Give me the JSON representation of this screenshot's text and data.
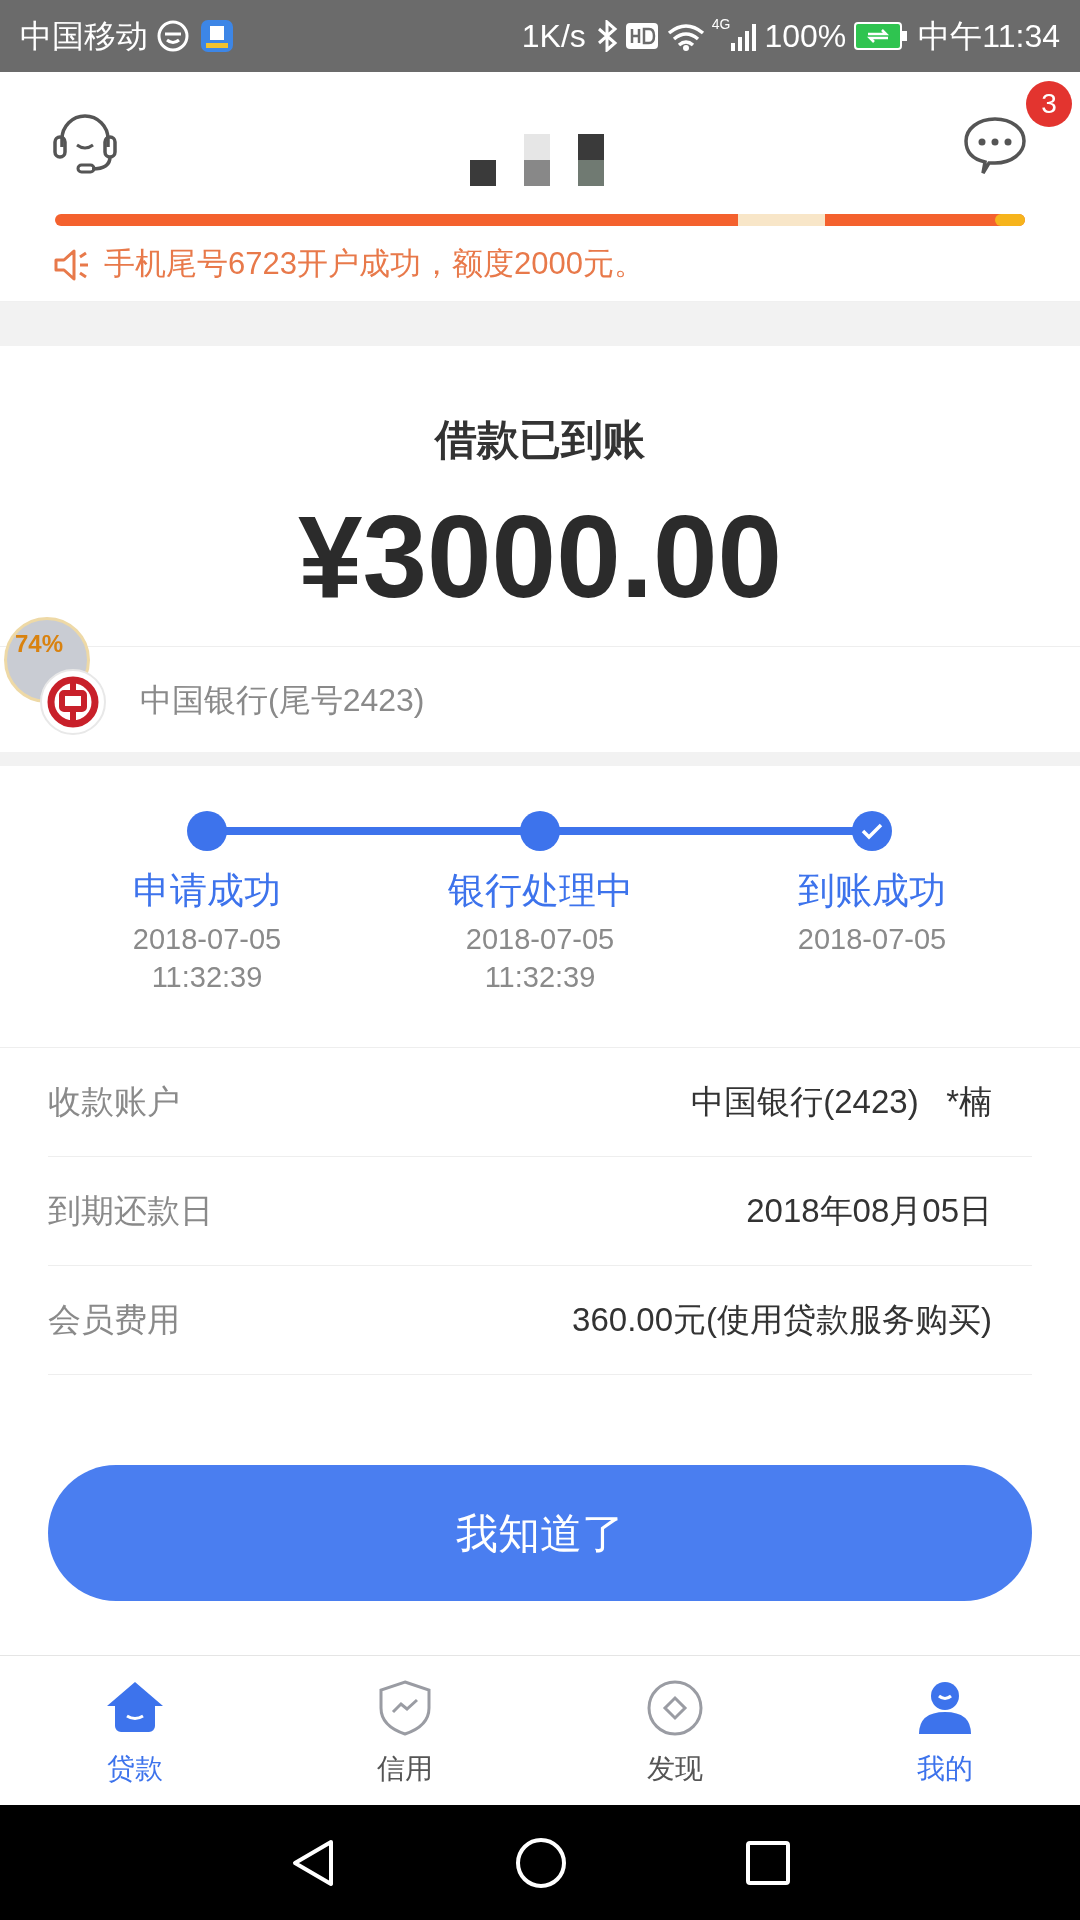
{
  "status_bar": {
    "carrier": "中国移动",
    "speed": "1K/s",
    "network": "4G",
    "battery": "100%",
    "time": "中午11:34"
  },
  "header": {
    "message_badge": "3"
  },
  "notice": {
    "text": "手机尾号6723开户成功，额度2000元。"
  },
  "result": {
    "title": "借款已到账",
    "amount": "¥3000.00"
  },
  "bank": {
    "text": "中国银行(尾号2423)"
  },
  "floating_widget": {
    "text": "74%"
  },
  "steps": [
    {
      "label": "申请成功",
      "date": "2018-07-05",
      "time": "11:32:39",
      "done": false
    },
    {
      "label": "银行处理中",
      "date": "2018-07-05",
      "time": "11:32:39",
      "done": false
    },
    {
      "label": "到账成功",
      "date": "2018-07-05",
      "done": true
    }
  ],
  "details": [
    {
      "label": "收款账户",
      "value": "中国银行(2423)   *楠"
    },
    {
      "label": "到期还款日",
      "value": "2018年08月05日"
    },
    {
      "label": "会员费用",
      "value": "360.00元(使用贷款服务购买)"
    }
  ],
  "button": "我知道了",
  "tabs": [
    {
      "label": "贷款",
      "kind": "home",
      "selected": true
    },
    {
      "label": "信用",
      "kind": "shield",
      "selected": false
    },
    {
      "label": "发现",
      "kind": "discover",
      "selected": false
    },
    {
      "label": "我的",
      "kind": "person",
      "selected": true
    }
  ]
}
